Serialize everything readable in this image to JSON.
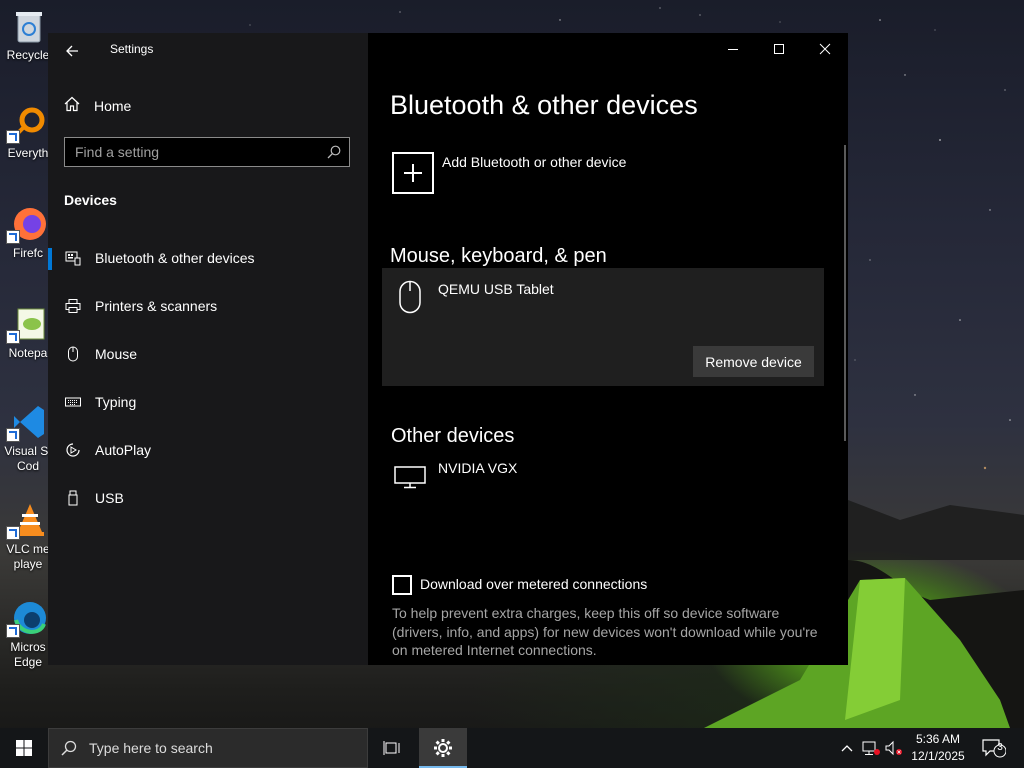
{
  "desktop": {
    "icons": [
      {
        "label": "Recycle",
        "name": "recycle-bin"
      },
      {
        "label": "Everyth",
        "name": "everything"
      },
      {
        "label": "Firefc",
        "name": "firefox"
      },
      {
        "label": "Notepa",
        "name": "notepad"
      },
      {
        "label": "Visual St Cod",
        "name": "vscode"
      },
      {
        "label": "VLC me playe",
        "name": "vlc"
      },
      {
        "label": "Micros Edge",
        "name": "edge"
      }
    ]
  },
  "window": {
    "title": "Settings",
    "controls": {
      "minimize": "minimize-icon",
      "maximize": "maximize-icon",
      "close": "close-icon"
    }
  },
  "sidebar": {
    "home_label": "Home",
    "search_placeholder": "Find a setting",
    "section_label": "Devices",
    "items": [
      {
        "label": "Bluetooth & other devices",
        "icon": "bluetooth-devices-icon",
        "active": true
      },
      {
        "label": "Printers & scanners",
        "icon": "printer-icon",
        "active": false
      },
      {
        "label": "Mouse",
        "icon": "mouse-icon",
        "active": false
      },
      {
        "label": "Typing",
        "icon": "keyboard-icon",
        "active": false
      },
      {
        "label": "AutoPlay",
        "icon": "autoplay-icon",
        "active": false
      },
      {
        "label": "USB",
        "icon": "usb-icon",
        "active": false
      }
    ]
  },
  "main": {
    "title": "Bluetooth & other devices",
    "add_device_label": "Add Bluetooth or other device",
    "mouse_section": "Mouse, keyboard, & pen",
    "mouse_device": "QEMU USB Tablet",
    "remove_button": "Remove device",
    "other_section": "Other devices",
    "other_device": "NVIDIA VGX",
    "metered_label": "Download over metered connections",
    "metered_checked": false,
    "metered_help": "To help prevent extra charges, keep this off so device software (drivers, info, and apps) for new devices won't download while you're on metered Internet connections."
  },
  "taskbar": {
    "search_placeholder": "Type here to search",
    "time": "5:36 AM",
    "date": "12/1/2025",
    "notification_count": "3"
  },
  "colors": {
    "accent": "#0078d7",
    "sidebar_bg": "#1a1a1c",
    "card_bg": "#1f1f1f",
    "button_bg": "#3a3a3a"
  }
}
